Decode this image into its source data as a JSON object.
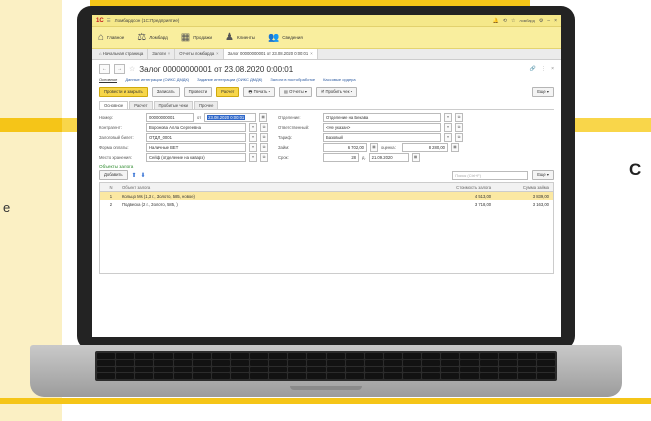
{
  "background": {
    "right_text": "С",
    "left_text": "е",
    "accent_color": "#f5c518"
  },
  "app": {
    "logo": "1С",
    "window_title": "Ломбардсон  (1С:Предприятие)",
    "login": "ломбард"
  },
  "sections": [
    {
      "label": "Главное",
      "icon": "home-icon"
    },
    {
      "label": "Ломбард",
      "icon": "scales-icon"
    },
    {
      "label": "Продажи",
      "icon": "cash-register-icon"
    },
    {
      "label": "Клиенты",
      "icon": "person-icon"
    },
    {
      "label": "Сведения",
      "icon": "people-icon"
    }
  ],
  "tabs": [
    {
      "label": "Начальная страница"
    },
    {
      "label": "Залоги"
    },
    {
      "label": "Отчеты ломбарда"
    },
    {
      "label": "Залог 00000000001 от 23.08.2020 0:00:01"
    }
  ],
  "document": {
    "title": "Залог 00000000001 от 23.08.2020 0:00:01",
    "links": {
      "main": "Основное",
      "l1": "Данные интеграции (ОИКС ДМДК)",
      "l2": "Задание интеграции (ОИКС ДМДК)",
      "l3": "Залоги в постобработке",
      "l4": "Кассовые ордера"
    },
    "commands": {
      "post_close": "Провести и закрыть",
      "save": "Записать",
      "post": "Провести",
      "calc": "Расчет",
      "print": "Печать",
      "reports": "Отчеты",
      "payment": "Пробить чек",
      "more": "Еще"
    },
    "subtabs": {
      "t1": "Основное",
      "t2": "Расчет",
      "t3": "Пробитые чеки",
      "t4": "Прочее"
    },
    "fields": {
      "number_label": "Номер:",
      "number_value": "00000000001",
      "date_label": "от",
      "date_value": "23.08.2020 0:00:01",
      "client_label": "Контрагент:",
      "client_value": "Воронова Алла Сергеевна",
      "ticket_label": "Залоговый билет:",
      "ticket_value": "ОТДЛ_0001",
      "payment_label": "Форма оплаты:",
      "payment_value": "Наличные ВЕТ",
      "storage_label": "Место хранения:",
      "storage_value": "Сейф (отделение на каварэ)",
      "branch_label": "Отделение:",
      "branch_value": "Отделение на Бекава",
      "resp_label": "Ответственный:",
      "resp_value": "<Не указан>",
      "tariff_label": "Тариф:",
      "tariff_value": "Базовый",
      "loan_label": "Займ:",
      "loan_value": "6 702,00",
      "estimate_label": "оценка:",
      "estimate_value": "8 280,00",
      "term_label": "Срок:",
      "term_days": "28",
      "term_unit": "д.",
      "term_date": "21.09.2020"
    },
    "table": {
      "title": "Объекты залога",
      "add": "Добавить",
      "search_placeholder": "Поиск (Ctrl+F)",
      "more": "Еще",
      "headers": {
        "n": "N",
        "object": "Объект залога",
        "cost": "Стоимость залога",
        "amount": "Сумма займа"
      },
      "rows": [
        {
          "n": "1",
          "object": "Кольцо Ms (1,3 г., Золото, 585, новое)",
          "cost": "4 513,00",
          "amount": "3 839,00"
        },
        {
          "n": "2",
          "object": "Подвеска (2 г., Золото, 585, )",
          "cost": "3 718,00",
          "amount": "3 163,00"
        }
      ]
    }
  }
}
